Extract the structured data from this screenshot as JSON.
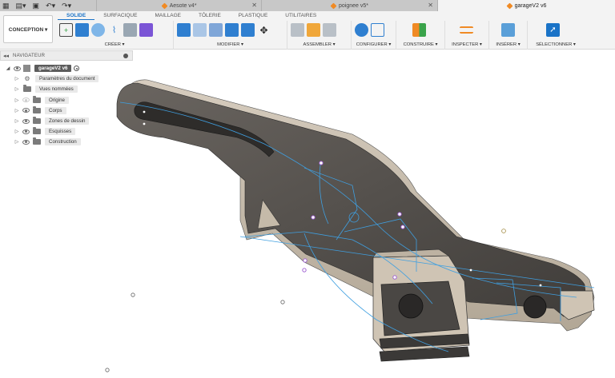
{
  "title_tabs": [
    {
      "name": "Aesote v4*",
      "active": false
    },
    {
      "name": "poignee v5*",
      "active": false
    },
    {
      "name": "garageV2 v6",
      "active": true
    }
  ],
  "workspace": {
    "label": "CONCEPTION ▾"
  },
  "ribbon_tabs": [
    "SOLIDE",
    "SURFACIQUE",
    "MAILLAGE",
    "TÔLERIE",
    "PLASTIQUE",
    "UTILITAIRES"
  ],
  "groups": {
    "create": "CRÉER ▾",
    "modify": "MODIFIER ▾",
    "assemble": "ASSEMBLER ▾",
    "configure": "CONFIGURER ▾",
    "construct": "CONSTRUIRE ▾",
    "inspect": "INSPECTER ▾",
    "insert": "INSÉRER ▾",
    "select": "SÉLECTIONNER ▾"
  },
  "navigator": {
    "title": "NAVIGATEUR",
    "root": "garageV2 v6",
    "items": [
      {
        "label": "Paramètres du document",
        "icon": "gear-icon"
      },
      {
        "label": "Vues nommées",
        "icon": "folder-icon"
      },
      {
        "label": "Origine",
        "icon": "folder-icon"
      },
      {
        "label": "Corps",
        "icon": "folder-icon"
      },
      {
        "label": "Zones de dessin",
        "icon": "folder-icon"
      },
      {
        "label": "Esquisses",
        "icon": "folder-icon"
      },
      {
        "label": "Construction",
        "icon": "folder-icon"
      }
    ]
  },
  "colors": {
    "accent": "#1a73c7",
    "body_dark": "#4a4744",
    "body_face": "#c9bfb0",
    "sketch": "#3f9fe0"
  }
}
